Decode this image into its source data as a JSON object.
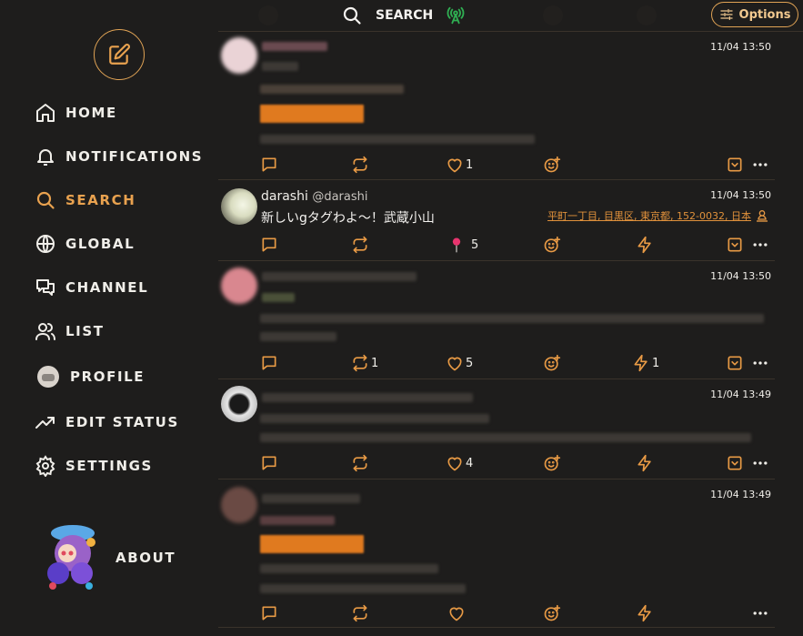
{
  "nav": {
    "items": [
      {
        "label": "HOME",
        "icon": "home-icon"
      },
      {
        "label": "NOTIFICATIONS",
        "icon": "bell-icon"
      },
      {
        "label": "SEARCH",
        "icon": "search-icon",
        "active": true
      },
      {
        "label": "GLOBAL",
        "icon": "globe-icon"
      },
      {
        "label": "CHANNEL",
        "icon": "chat-icon"
      },
      {
        "label": "LIST",
        "icon": "users-icon"
      },
      {
        "label": "PROFILE",
        "icon": "profile-avatar"
      },
      {
        "label": "EDIT STATUS",
        "icon": "trend-icon"
      },
      {
        "label": "SETTINGS",
        "icon": "gear-icon"
      }
    ],
    "about_label": "ABOUT"
  },
  "header": {
    "title": "SEARCH",
    "options_label": "Options"
  },
  "colors": {
    "accent": "#e9a24f",
    "background": "#1e1d1c",
    "divider": "#3a332b",
    "live": "#2fae52"
  },
  "posts": [
    {
      "time": "11/04 13:50",
      "counts": {
        "renote": "",
        "like": "1",
        "lightning": ""
      }
    },
    {
      "time": "11/04 13:50",
      "name": "darashi",
      "handle": "@darashi",
      "content": "新しいgタグわよ〜！武蔵小山",
      "location": "平町一丁目, 目黒区, 東京都, 152-0032, 日本",
      "counts": {
        "reaction": "5"
      }
    },
    {
      "time": "11/04 13:50",
      "counts": {
        "renote": "1",
        "like": "5",
        "lightning": "1"
      }
    },
    {
      "time": "11/04 13:49",
      "counts": {
        "renote": "",
        "like": "4",
        "lightning": ""
      }
    },
    {
      "time": "11/04 13:49",
      "counts": {
        "renote": "",
        "like": "",
        "lightning": ""
      }
    }
  ]
}
